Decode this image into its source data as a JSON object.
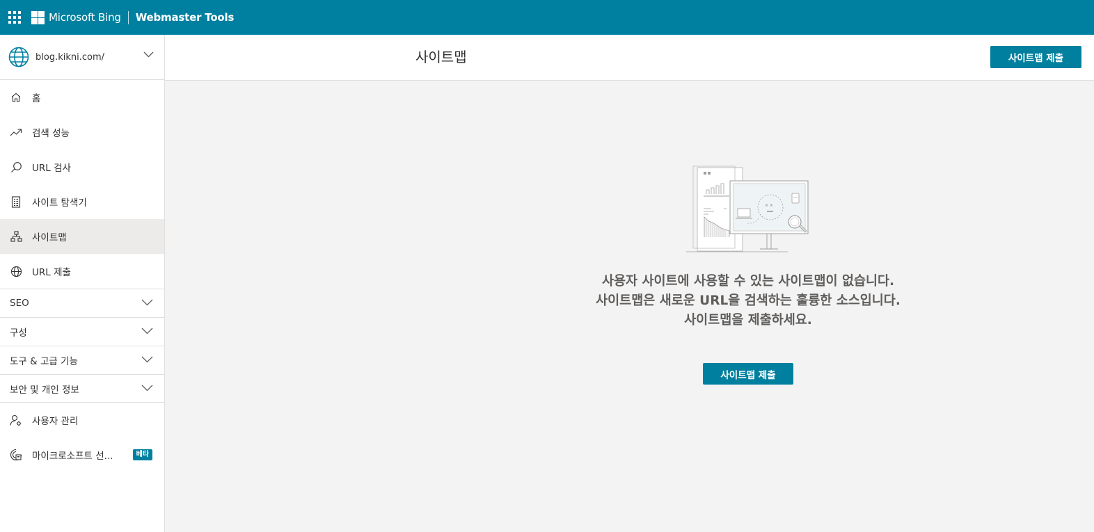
{
  "topbar": {
    "brand": "Microsoft Bing",
    "product": "Webmaster Tools",
    "app_launcher_icon": "waffle-icon",
    "logo_icon": "microsoft-logo-icon",
    "background_color": "#0080a0"
  },
  "sidebar": {
    "site": {
      "url": "blog.kikni.com/",
      "icon": "globe-icon",
      "chevron": "chevron-down-icon"
    },
    "items": [
      {
        "label": "홈",
        "icon": "home-icon",
        "active": false
      },
      {
        "label": "검색 성능",
        "icon": "trend-icon",
        "active": false
      },
      {
        "label": "URL 검사",
        "icon": "search-icon",
        "active": false
      },
      {
        "label": "사이트 탐색기",
        "icon": "document-list-icon",
        "active": false
      },
      {
        "label": "사이트맵",
        "icon": "sitemap-icon",
        "active": true
      },
      {
        "label": "URL 제출",
        "icon": "globe-icon",
        "active": false
      }
    ],
    "groups": [
      {
        "label": "SEO"
      },
      {
        "label": "구성"
      },
      {
        "label": "도구 & 고급 기능"
      },
      {
        "label": "보안 및 개인 정보"
      }
    ],
    "bottom_items": [
      {
        "label": "사용자 관리",
        "icon": "user-settings-icon"
      },
      {
        "label": "마이크로소프트 선...",
        "icon": "clarity-icon",
        "badge": "베타"
      }
    ]
  },
  "header": {
    "title": "사이트맵",
    "submit_button": "사이트맵 제출"
  },
  "main": {
    "illustration_icon": "empty-state-illustration",
    "empty_lines": [
      "사용자 사이트에 사용할 수 있는 사이트맵이 없습니다.",
      "사이트맵은 새로운 URL을 검색하는 훌륭한 소스입니다.",
      "사이트맵을 제출하세요."
    ],
    "submit_button": "사이트맵 제출"
  },
  "colors": {
    "accent": "#00809e",
    "active_item_bg": "#edebe9",
    "page_bg": "#f3f3f3"
  }
}
